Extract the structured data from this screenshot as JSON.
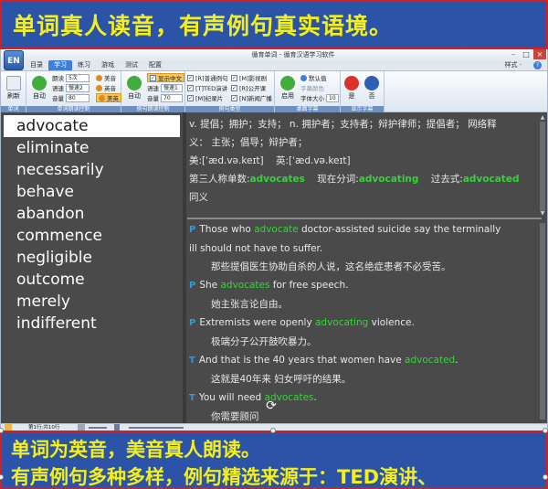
{
  "banner_top": "单词真人读音，有声例句真实语境。",
  "window": {
    "title": "循育单词 - 循育汉语学习软件",
    "logo": "EN",
    "tabs": [
      "目录",
      "学习",
      "练习",
      "游戏",
      "测试",
      "配置"
    ],
    "active_tab": 1,
    "style_menu": "样式 ·",
    "help": "?"
  },
  "ribbon": {
    "g1": {
      "refresh": "刷新",
      "label": "单词"
    },
    "g2": {
      "auto": "自动",
      "read_label": "朗读",
      "read_val": "5次",
      "speed_label": "语速",
      "speed_val": "慢速2",
      "volume_label": "音量",
      "volume_val": "80",
      "us": "美音",
      "uk": "英音",
      "show_us": "美英",
      "label": "单词朗读控制"
    },
    "g3": {
      "auto": "自动",
      "speed_label": "语速",
      "speed_val": "慢速1",
      "volume_label": "音量",
      "volume_val": "70",
      "show_cn": "显示中文",
      "label": "例句朗读控制"
    },
    "g4": {
      "c1": "[R]普通例句",
      "c2": "[T]TED演讲",
      "c3": "[M]纪录片",
      "c4": "[M]影视剧",
      "c5": "[R]公开课",
      "c6": "[N]新闻广播",
      "label": "例句类型"
    },
    "g5": {
      "enable": "启用",
      "default": "默认值",
      "font_color": "字幕颜色",
      "font_size": "字体大小",
      "font_size_val": "10",
      "label": "桌面字幕"
    },
    "g6": {
      "b1": "是",
      "b2": "否",
      "label": "显示字幕"
    }
  },
  "wordlist": [
    "advocate",
    "eliminate",
    "necessarily",
    "behave",
    "abandon",
    "commence",
    "negligible",
    "outcome",
    "merely",
    "indifferent"
  ],
  "selected_index": 0,
  "definition": {
    "line1": "v. 提倡；拥护；支持；  n. 拥护者；支持者；辩护律师；提倡者；  网络释",
    "line2": "义：  主张；倡导；辩护者；",
    "phon_us_label": "美:",
    "phon_us": "[ˈæd.və.keɪt]",
    "phon_uk_label": "英:",
    "phon_uk": "[ˈæd.və.keɪt]",
    "forms_a": "第三人称单数:",
    "forms_a_val": "advocates",
    "forms_b": "现在分词:",
    "forms_b_val": "advocating",
    "forms_c": "过去式:",
    "forms_c_val": "advocated",
    "line_tail": "同义"
  },
  "examples": [
    {
      "tag": "P",
      "pre": "Those who ",
      "hl": "advocate",
      "post": " doctor-assisted suicide say the terminally",
      "wrap": "ill should not have to suffer.",
      "cn": "那些提倡医生协助自杀的人说，这名绝症患者不必受苦。"
    },
    {
      "tag": "P",
      "pre": "She ",
      "hl": "advocates",
      "post": " for free speech.",
      "wrap": "",
      "cn": "她主张言论自由。"
    },
    {
      "tag": "P",
      "pre": "Extremists were openly ",
      "hl": "advocating",
      "post": " violence.",
      "wrap": "",
      "cn": "极端分子公开鼓吹暴力。"
    },
    {
      "tag": "T",
      "pre": "And that is the 40 years that women have ",
      "hl": "advocated",
      "post": ".",
      "wrap": "",
      "cn": "这就是40年来 妇女呼吁的结果。"
    },
    {
      "tag": "T",
      "pre": "You will need ",
      "hl": "advocates",
      "post": ".",
      "wrap": "",
      "cn": "你需要顾问"
    }
  ],
  "statusbar": {
    "page": "第1行;共10行"
  },
  "banner_bottom": {
    "line1": "单词为英音，美音真人朗读。",
    "line2": "有声例句多种多样，例句精选来源于：TED演讲、"
  }
}
